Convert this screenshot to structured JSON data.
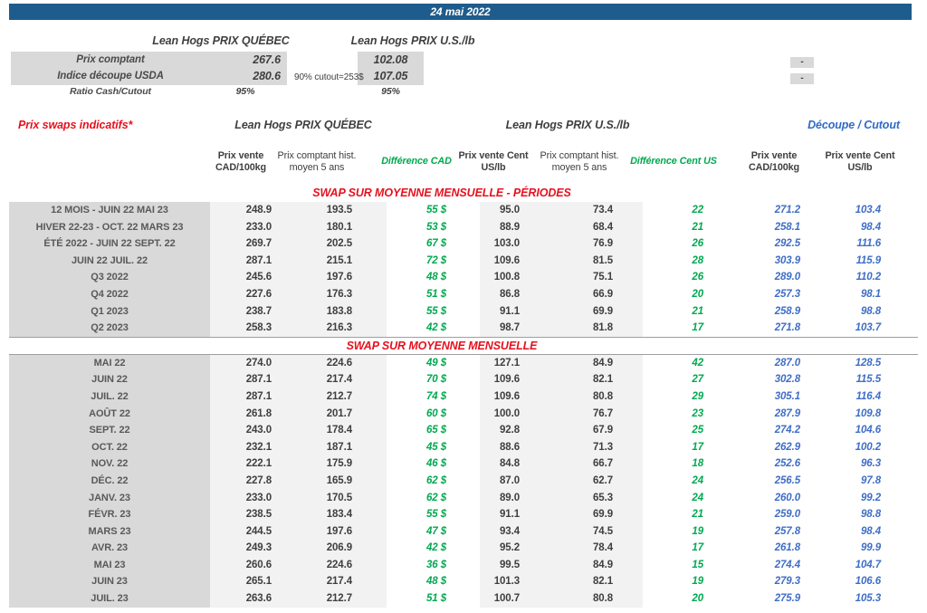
{
  "banner": {
    "date": "24 mai 2022"
  },
  "top": {
    "quebec_header": "Lean Hogs PRIX QUÉBEC",
    "us_header": "Lean Hogs PRIX U.S./lb",
    "row_labels": [
      "Prix comptant",
      "Indice découpe USDA",
      "Ratio Cash/Cutout"
    ],
    "quebec_values": [
      "267.6",
      "280.6",
      "95%"
    ],
    "us_values": [
      "102.08",
      "107.05",
      "95%"
    ],
    "cutout_note": "90% cutout=253$",
    "right_dashes": [
      "-",
      "-"
    ]
  },
  "swaps": {
    "title": "Prix swaps indicatifs*",
    "quebec_header": "Lean Hogs PRIX QUÉBEC",
    "us_header": "Lean Hogs PRIX U.S./lb",
    "cutout_header": "Découpe / Cutout",
    "col_headers": [
      "Prix vente CAD/100kg",
      "Prix comptant hist. moyen 5 ans",
      "Différence CAD",
      "Prix vente Cent US/lb",
      "Prix comptant hist. moyen 5 ans",
      "Différence Cent US",
      "Prix vente CAD/100kg",
      "Prix vente Cent US/lb"
    ],
    "periods_title": "SWAP SUR MOYENNE MENSUELLE - PÉRIODES",
    "monthly_title": "SWAP SUR MOYENNE MENSUELLE",
    "periods": [
      {
        "label": "12 MOIS - JUIN 22 MAI 23",
        "values": [
          "248.9",
          "193.5",
          "55 $",
          "95.0",
          "73.4",
          "22",
          "271.2",
          "103.4"
        ]
      },
      {
        "label": "HIVER 22-23 - OCT. 22 MARS 23",
        "values": [
          "233.0",
          "180.1",
          "53 $",
          "88.9",
          "68.4",
          "21",
          "258.1",
          "98.4"
        ]
      },
      {
        "label": "ÉTÉ 2022 - JUIN 22 SEPT. 22",
        "values": [
          "269.7",
          "202.5",
          "67 $",
          "103.0",
          "76.9",
          "26",
          "292.5",
          "111.6"
        ]
      },
      {
        "label": "JUIN 22 JUIL. 22",
        "values": [
          "287.1",
          "215.1",
          "72 $",
          "109.6",
          "81.5",
          "28",
          "303.9",
          "115.9"
        ]
      },
      {
        "label": "Q3 2022",
        "values": [
          "245.6",
          "197.6",
          "48 $",
          "100.8",
          "75.1",
          "26",
          "289.0",
          "110.2"
        ]
      },
      {
        "label": "Q4 2022",
        "values": [
          "227.6",
          "176.3",
          "51 $",
          "86.8",
          "66.9",
          "20",
          "257.3",
          "98.1"
        ]
      },
      {
        "label": "Q1 2023",
        "values": [
          "238.7",
          "183.8",
          "55 $",
          "91.1",
          "69.9",
          "21",
          "258.9",
          "98.8"
        ]
      },
      {
        "label": "Q2 2023",
        "values": [
          "258.3",
          "216.3",
          "42 $",
          "98.7",
          "81.8",
          "17",
          "271.8",
          "103.7"
        ]
      }
    ],
    "monthly": [
      {
        "label": "MAI 22",
        "values": [
          "274.0",
          "224.6",
          "49 $",
          "127.1",
          "84.9",
          "42",
          "287.0",
          "128.5"
        ]
      },
      {
        "label": "JUIN 22",
        "values": [
          "287.1",
          "217.4",
          "70 $",
          "109.6",
          "82.1",
          "27",
          "302.8",
          "115.5"
        ]
      },
      {
        "label": "JUIL. 22",
        "values": [
          "287.1",
          "212.7",
          "74 $",
          "109.6",
          "80.8",
          "29",
          "305.1",
          "116.4"
        ]
      },
      {
        "label": "AOÛT 22",
        "values": [
          "261.8",
          "201.7",
          "60 $",
          "100.0",
          "76.7",
          "23",
          "287.9",
          "109.8"
        ]
      },
      {
        "label": "SEPT. 22",
        "values": [
          "243.0",
          "178.4",
          "65 $",
          "92.8",
          "67.9",
          "25",
          "274.2",
          "104.6"
        ]
      },
      {
        "label": "OCT. 22",
        "values": [
          "232.1",
          "187.1",
          "45 $",
          "88.6",
          "71.3",
          "17",
          "262.9",
          "100.2"
        ]
      },
      {
        "label": "NOV. 22",
        "values": [
          "222.1",
          "175.9",
          "46 $",
          "84.8",
          "66.7",
          "18",
          "252.6",
          "96.3"
        ]
      },
      {
        "label": "DÉC. 22",
        "values": [
          "227.8",
          "165.9",
          "62 $",
          "87.0",
          "62.7",
          "24",
          "256.5",
          "97.8"
        ]
      },
      {
        "label": "JANV. 23",
        "values": [
          "233.0",
          "170.5",
          "62 $",
          "89.0",
          "65.3",
          "24",
          "260.0",
          "99.2"
        ]
      },
      {
        "label": "FÉVR. 23",
        "values": [
          "238.5",
          "183.4",
          "55 $",
          "91.1",
          "69.9",
          "21",
          "259.0",
          "98.8"
        ]
      },
      {
        "label": "MARS 23",
        "values": [
          "244.5",
          "197.6",
          "47 $",
          "93.4",
          "74.5",
          "19",
          "257.8",
          "98.4"
        ]
      },
      {
        "label": "AVR. 23",
        "values": [
          "249.3",
          "206.9",
          "42 $",
          "95.2",
          "78.4",
          "17",
          "261.8",
          "99.9"
        ]
      },
      {
        "label": "MAI 23",
        "values": [
          "260.6",
          "224.6",
          "36 $",
          "99.5",
          "84.9",
          "15",
          "274.4",
          "104.7"
        ]
      },
      {
        "label": "JUIN 23",
        "values": [
          "265.1",
          "217.4",
          "48 $",
          "101.3",
          "82.1",
          "19",
          "279.3",
          "106.6"
        ]
      },
      {
        "label": "JUIL. 23",
        "values": [
          "263.6",
          "212.7",
          "51 $",
          "100.7",
          "80.8",
          "20",
          "275.9",
          "105.3"
        ]
      }
    ]
  },
  "colors": {
    "banner_blue": "#1E5C8D",
    "red": "#E6111E",
    "green": "#00A94F",
    "blue": "#3F6EC6",
    "label_bg": "#D9D9D9",
    "cell_bg": "#F2F2F2"
  }
}
